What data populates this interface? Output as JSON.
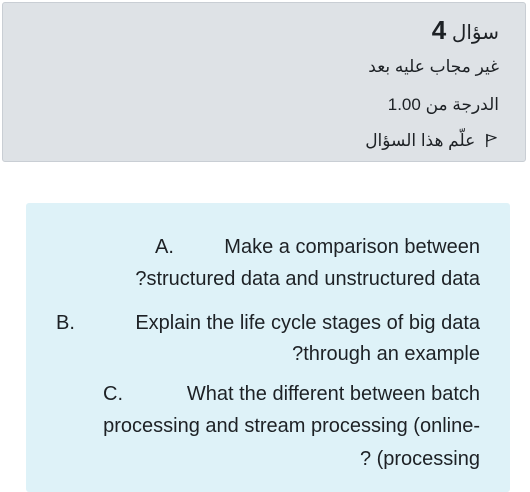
{
  "question_info": {
    "title_word": "سؤال",
    "number": "4",
    "status": "غير مجاب عليه بعد",
    "grade_label": "الدرجة من",
    "grade_value": "1.00",
    "flag_label": "علّم هذا السؤال",
    "flag_icon": "flag-outline-icon"
  },
  "question_text": {
    "a_letter": "A.",
    "a_line1": "Make a comparison between",
    "a_line2": "?structured  data and unstructured data",
    "b_letter": "B.",
    "b_line1": "Explain the life cycle stages of big data",
    "b_line2": "?through an example",
    "c_letter": "C.",
    "c_line1": "What the different between batch",
    "c_line2": "processing and stream processing (online-",
    "c_line3": "? (processing"
  },
  "colors": {
    "info_bg": "#dee2e6",
    "content_bg": "#def2f8",
    "text": "#1d2125"
  }
}
